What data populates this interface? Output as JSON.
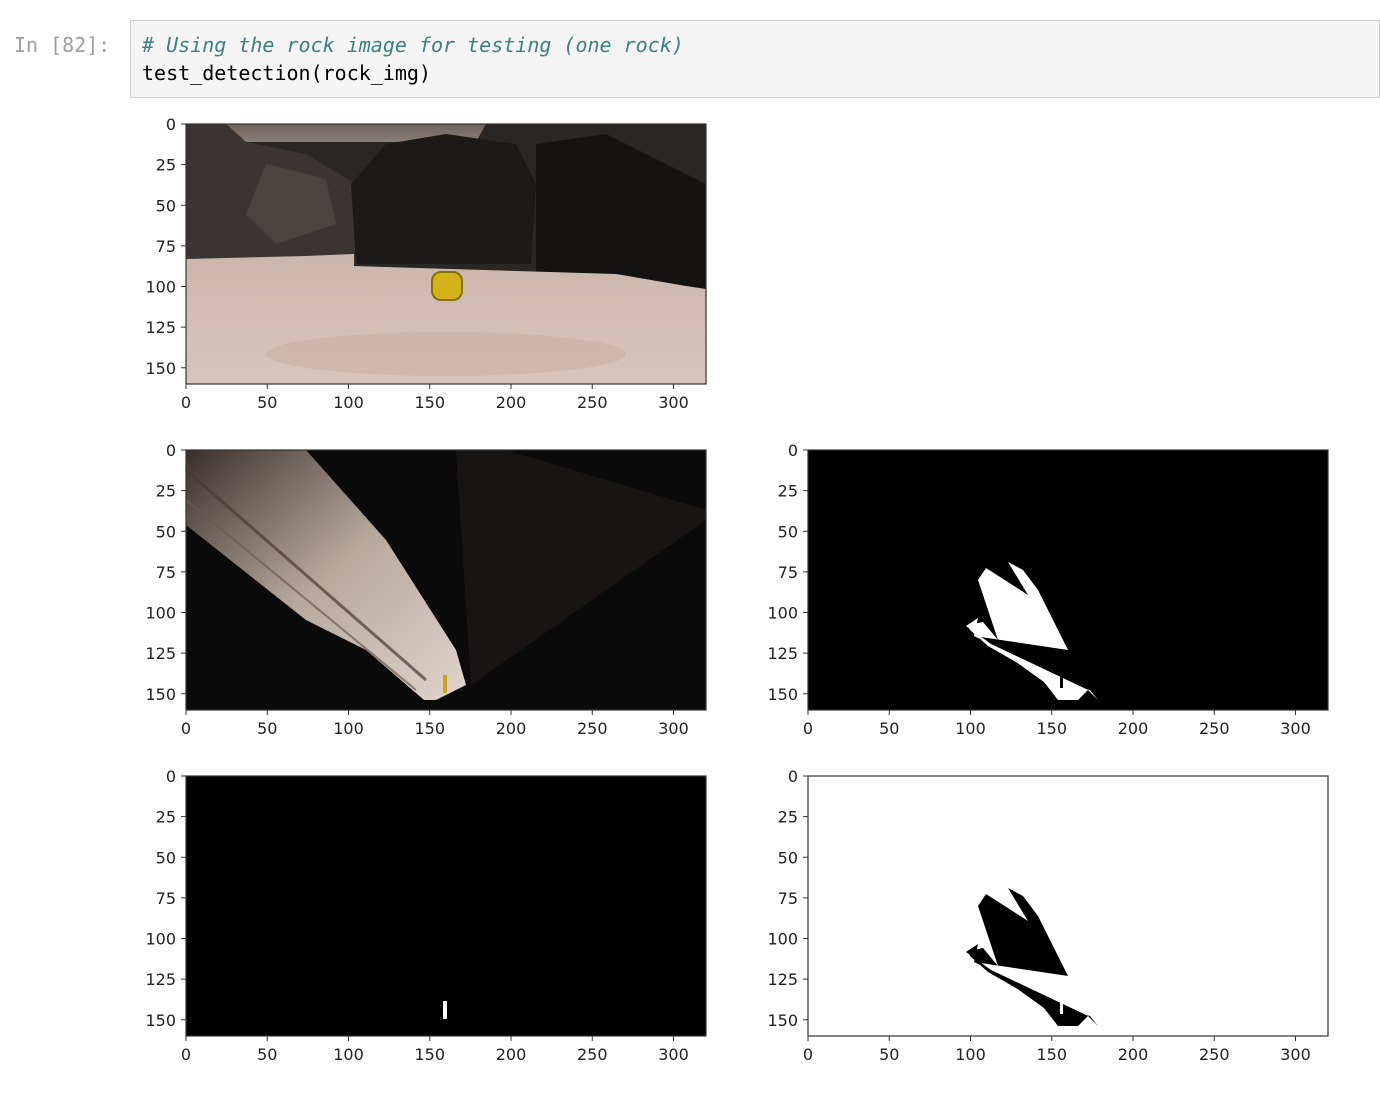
{
  "cell": {
    "prompt": "In [82]:",
    "code_lines": [
      "# Using the rock image for testing (one rock)",
      "test_detection(rock_img)"
    ]
  },
  "chart_data": [
    {
      "type": "heatmap",
      "content": "camera image: rover view of terrain with a yellow rock sample",
      "x_ticks": [
        "0",
        "50",
        "100",
        "150",
        "200",
        "250",
        "300"
      ],
      "y_ticks": [
        "0",
        "25",
        "50",
        "75",
        "100",
        "125",
        "150"
      ],
      "xlim": [
        0,
        320
      ],
      "ylim": [
        160,
        0
      ],
      "grid": false
    },
    {
      "type": "heatmap",
      "content": "perspective-warped top-down view",
      "x_ticks": [
        "0",
        "50",
        "100",
        "150",
        "200",
        "250",
        "300"
      ],
      "y_ticks": [
        "0",
        "25",
        "50",
        "75",
        "100",
        "125",
        "150"
      ],
      "xlim": [
        0,
        320
      ],
      "ylim": [
        160,
        0
      ],
      "grid": false
    },
    {
      "type": "heatmap",
      "content": "navigable terrain threshold (white on black)",
      "x_ticks": [
        "0",
        "50",
        "100",
        "150",
        "200",
        "250",
        "300"
      ],
      "y_ticks": [
        "0",
        "25",
        "50",
        "75",
        "100",
        "125",
        "150"
      ],
      "xlim": [
        0,
        320
      ],
      "ylim": [
        160,
        0
      ],
      "grid": false
    },
    {
      "type": "heatmap",
      "content": "rock threshold (white on black)",
      "x_ticks": [
        "0",
        "50",
        "100",
        "150",
        "200",
        "250",
        "300"
      ],
      "y_ticks": [
        "0",
        "25",
        "50",
        "75",
        "100",
        "125",
        "150"
      ],
      "xlim": [
        0,
        320
      ],
      "ylim": [
        160,
        0
      ],
      "grid": false
    },
    {
      "type": "heatmap",
      "content": "obstacle map (black on white)",
      "x_ticks": [
        "0",
        "50",
        "100",
        "150",
        "200",
        "250",
        "300"
      ],
      "y_ticks": [
        "0",
        "25",
        "50",
        "75",
        "100",
        "125",
        "150"
      ],
      "xlim": [
        0,
        320
      ],
      "ylim": [
        160,
        0
      ],
      "grid": false
    }
  ]
}
